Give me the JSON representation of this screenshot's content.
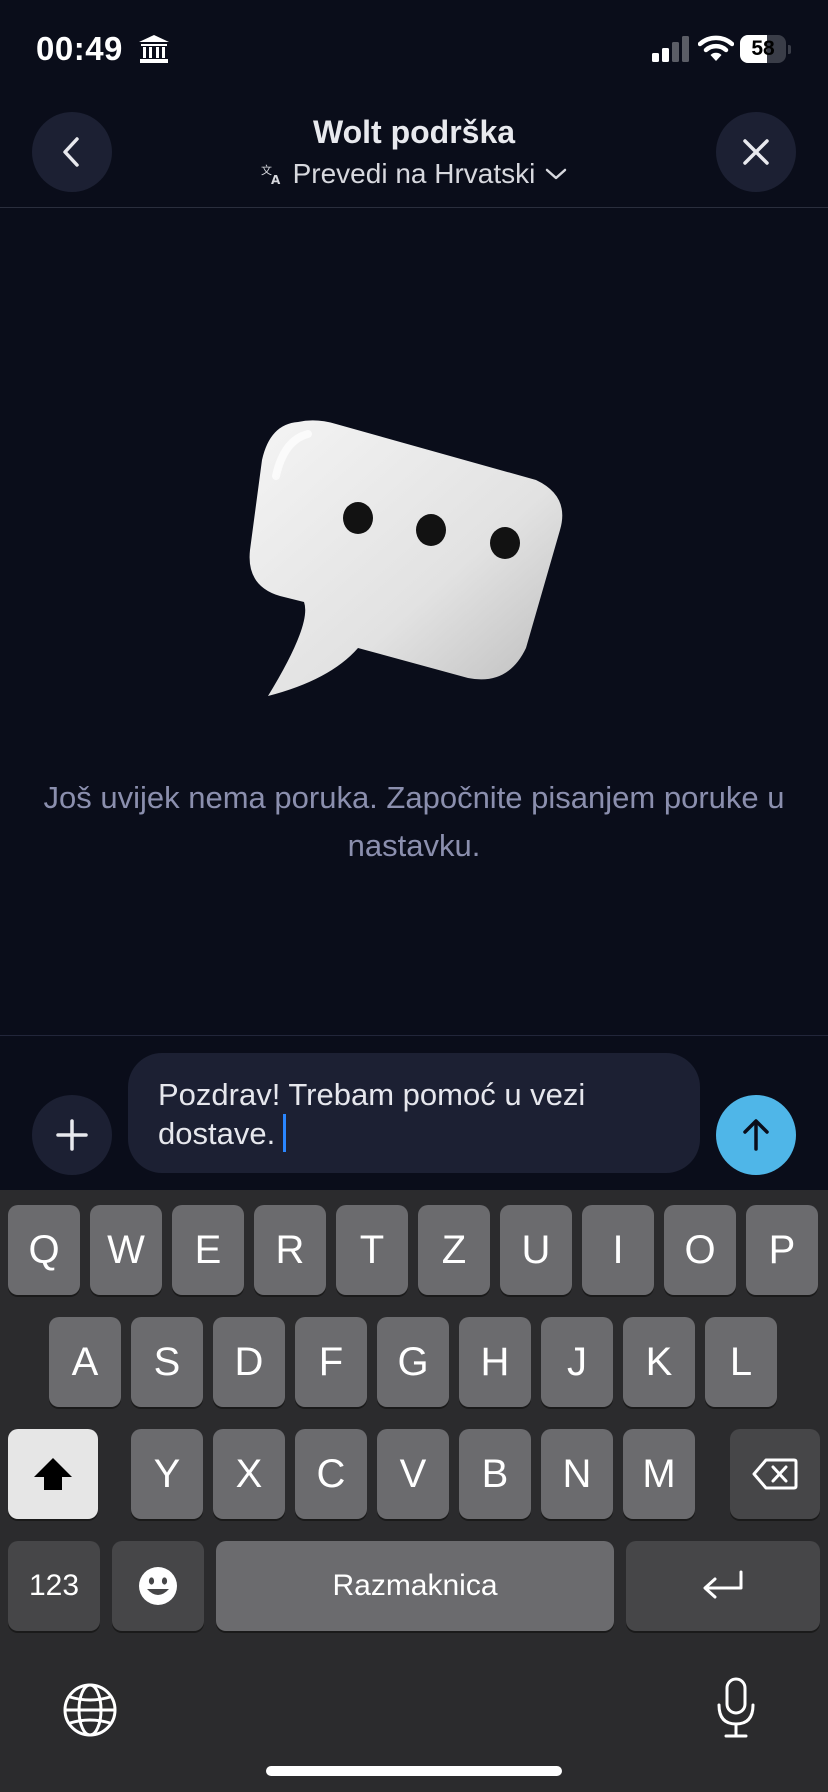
{
  "status_bar": {
    "time": "00:49",
    "battery_level": "58",
    "battery_fraction": 0.58,
    "icons": [
      "bank-icon",
      "signal-icon",
      "wifi-icon",
      "battery-icon"
    ]
  },
  "header": {
    "title": "Wolt podrška",
    "translate_label": "Prevedi na Hrvatski",
    "icons": {
      "back": "chevron-left-icon",
      "close": "close-icon",
      "translate": "translate-icon",
      "dropdown": "chevron-down-icon"
    }
  },
  "empty_state": {
    "message": "Još uvijek nema poruka. Započnite pisanjem poruke u nastavku.",
    "illustration": "chat-bubble-icon"
  },
  "composer": {
    "input_value": "Pozdrav! Trebam pomoć u vezi dostave.",
    "icons": {
      "add": "plus-icon",
      "send": "arrow-up-icon"
    }
  },
  "keyboard": {
    "row1": [
      "Q",
      "W",
      "E",
      "R",
      "T",
      "Z",
      "U",
      "I",
      "O",
      "P"
    ],
    "row2": [
      "A",
      "S",
      "D",
      "F",
      "G",
      "H",
      "J",
      "K",
      "L"
    ],
    "row3": [
      "Y",
      "X",
      "C",
      "V",
      "B",
      "N",
      "M"
    ],
    "numbers_label": "123",
    "space_label": "Razmaknica",
    "icons": {
      "shift": "shift-icon",
      "backspace": "backspace-icon",
      "emoji": "emoji-icon",
      "return": "return-icon",
      "globe": "globe-icon",
      "mic": "microphone-icon"
    }
  },
  "colors": {
    "background": "#0a0d1a",
    "accent": "#4fb6e8",
    "caret": "#2a86ff",
    "muted_text": "#8b8fae"
  }
}
